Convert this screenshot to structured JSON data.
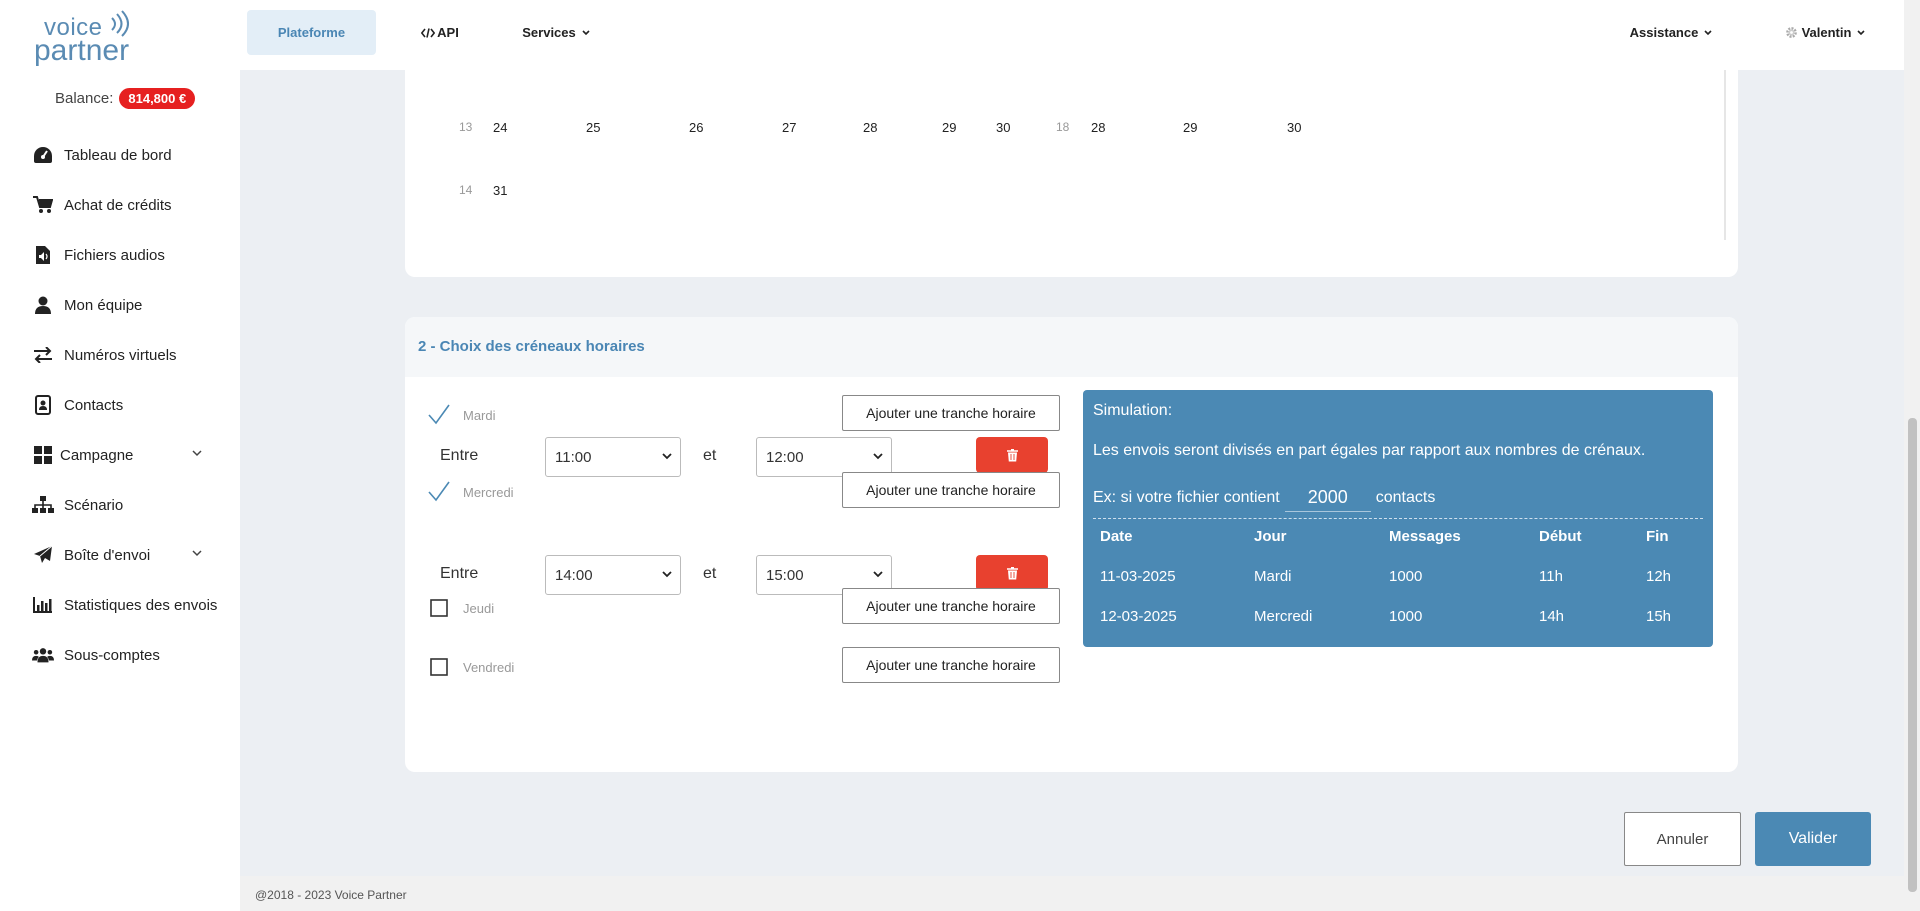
{
  "logo": {
    "line1": "voice",
    "line2": "partner"
  },
  "balance": {
    "label": "Balance:",
    "value": "814,800 €"
  },
  "sidebar": {
    "items": [
      {
        "label": "Tableau de bord",
        "icon": "dashboard-icon"
      },
      {
        "label": "Achat de crédits",
        "icon": "cart-icon"
      },
      {
        "label": "Fichiers audios",
        "icon": "audio-file-icon"
      },
      {
        "label": "Mon équipe",
        "icon": "user-icon"
      },
      {
        "label": "Numéros virtuels",
        "icon": "exchange-icon"
      },
      {
        "label": "Contacts",
        "icon": "contact-book-icon"
      },
      {
        "label": "Campagne",
        "icon": "grid-icon"
      },
      {
        "label": "Scénario",
        "icon": "sitemap-icon"
      },
      {
        "label": "Boîte d'envoi",
        "icon": "paper-plane-icon"
      },
      {
        "label": "Statistiques des envois",
        "icon": "bar-chart-icon"
      },
      {
        "label": "Sous-comptes",
        "icon": "users-icon"
      }
    ]
  },
  "topbar": {
    "tabs": [
      {
        "label": "Plateforme"
      },
      {
        "label": "API"
      },
      {
        "label": "Services"
      }
    ],
    "assistance": "Assistance",
    "user": "Valentin"
  },
  "calendar": {
    "row1": {
      "week": "13",
      "days": [
        "24",
        "25",
        "26",
        "27",
        "28",
        "29",
        "30"
      ],
      "week2": "18",
      "days2": [
        "28",
        "29",
        "30"
      ]
    },
    "row2": {
      "week": "14",
      "days": [
        "31"
      ]
    }
  },
  "timeslots": {
    "title": "2 - Choix des créneaux horaires",
    "add_label": "Ajouter une tranche horaire",
    "entre_label": "Entre",
    "et_label": "et",
    "days": [
      {
        "name": "Mardi",
        "checked": true,
        "from": "11:00",
        "to": "12:00"
      },
      {
        "name": "Mercredi",
        "checked": true,
        "from": "14:00",
        "to": "15:00"
      },
      {
        "name": "Jeudi",
        "checked": false
      },
      {
        "name": "Vendredi",
        "checked": false
      }
    ]
  },
  "simulation": {
    "title": "Simulation:",
    "description": "Les envois seront divisés en part égales par rapport aux nombres de crénaux.",
    "example_prefix": "Ex: si votre fichier contient",
    "contacts_value": "2000",
    "example_suffix": "contacts",
    "headers": [
      "Date",
      "Jour",
      "Messages",
      "Début",
      "Fin"
    ],
    "rows": [
      [
        "11-03-2025",
        "Mardi",
        "1000",
        "11h",
        "12h"
      ],
      [
        "12-03-2025",
        "Mercredi",
        "1000",
        "14h",
        "15h"
      ]
    ]
  },
  "actions": {
    "cancel": "Annuler",
    "validate": "Valider"
  },
  "footer": {
    "text": "@2018 - 2023 Voice Partner"
  },
  "colors": {
    "accent": "#4b89b4",
    "danger": "#e8412f",
    "badge": "#e62020"
  }
}
